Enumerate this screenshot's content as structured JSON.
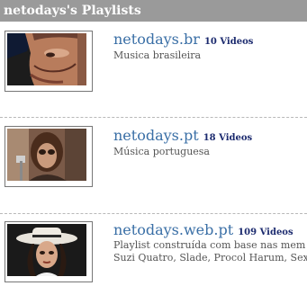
{
  "header": {
    "title": "netodays's Playlists"
  },
  "playlists": [
    {
      "name": "netodays.br",
      "count": "10 Videos",
      "description": [
        "Musica brasileira"
      ]
    },
    {
      "name": "netodays.pt",
      "count": "18 Videos",
      "description": [
        "Música portuguesa"
      ]
    },
    {
      "name": "netodays.web.pt",
      "count": "109 Videos",
      "description": [
        "Playlist construída com base nas mem",
        "Suzi Quatro, Slade, Procol Harum, Sex"
      ]
    }
  ],
  "colors": {
    "header_bg": "#9a9a9a",
    "link": "#3a6fa6",
    "count": "#1b2a6e"
  }
}
